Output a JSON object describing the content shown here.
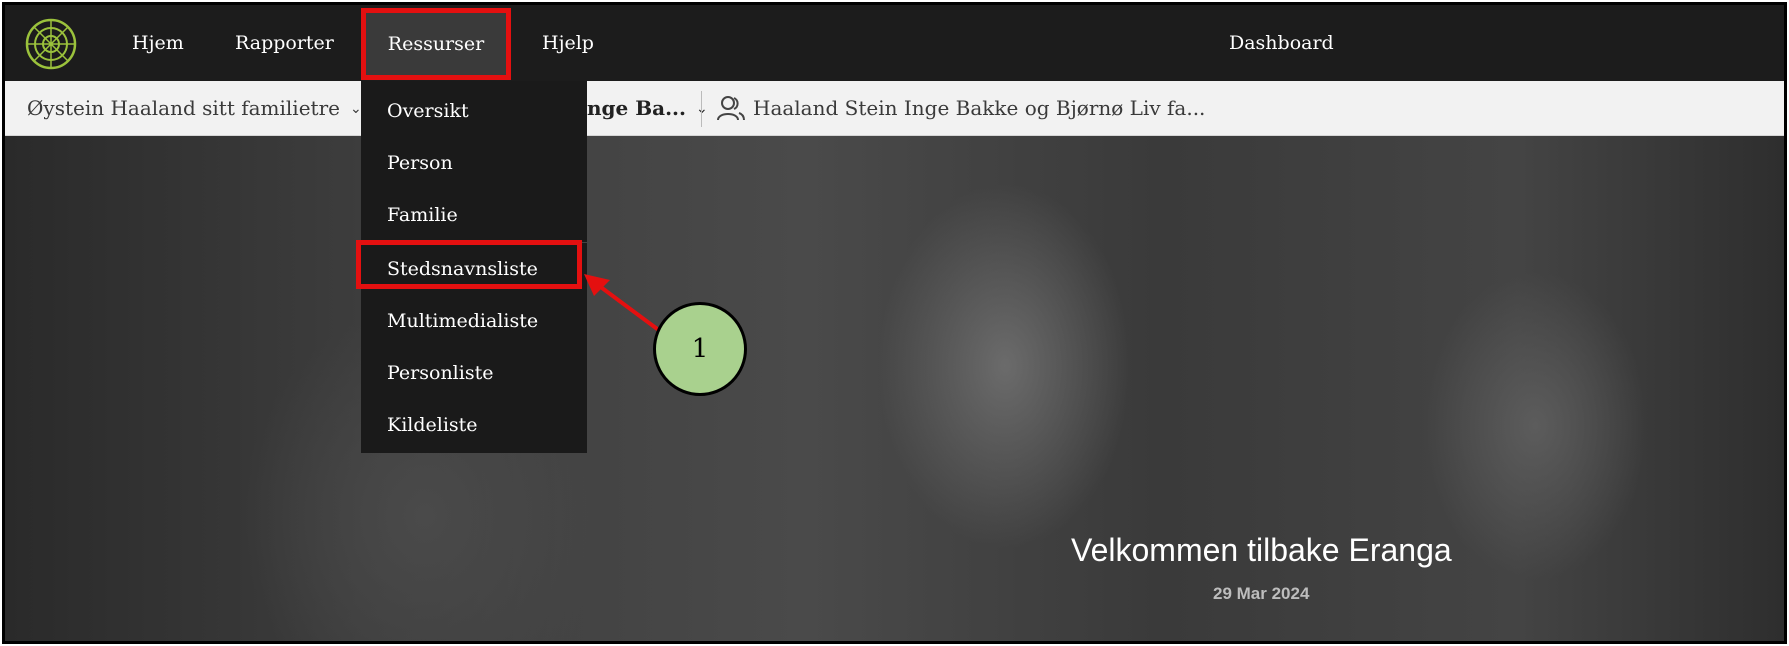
{
  "topnav": {
    "items": [
      "Hjem",
      "Rapporter",
      "Ressurser",
      "Hjelp"
    ],
    "dashboard": "Dashboard"
  },
  "subbar": {
    "tree_selector": "Øystein Haaland sitt familietre",
    "person_selector": "nge Ba...",
    "family_label": "Haaland Stein Inge Bakke og Bjørnø Liv fa..."
  },
  "dropdown": {
    "items": [
      "Oversikt",
      "Person",
      "Familie",
      "Stedsnavnsliste",
      "Multimedialiste",
      "Personliste",
      "Kildeliste"
    ]
  },
  "hero": {
    "welcome": "Velkommen tilbake Eranga",
    "date": "29 Mar 2024"
  },
  "annotation": {
    "callout_number": "1",
    "colors": {
      "highlight": "#e41010",
      "callout": "#a9d18e"
    }
  },
  "icons": {
    "logo": "tree-logo-icon",
    "chevron": "chevron-down-icon",
    "people": "people-icon"
  }
}
